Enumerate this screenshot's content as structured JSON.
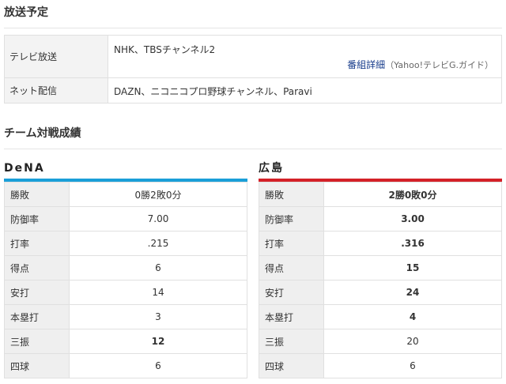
{
  "broadcast": {
    "title": "放送予定",
    "rows": [
      {
        "label": "テレビ放送",
        "value": "NHK、TBSチャンネル2",
        "detail_link": "番組詳細",
        "detail_source": "（Yahoo!テレビG.ガイド）"
      },
      {
        "label": "ネット配信",
        "value": "DAZN、ニコニコプロ野球チャンネル、Paravi"
      }
    ]
  },
  "record": {
    "title": "チーム対戦成績",
    "teams": [
      {
        "name": "DeNA",
        "color": "#1a9fd8",
        "stats": [
          {
            "label": "勝敗",
            "value": "0勝2敗0分",
            "bold": false
          },
          {
            "label": "防御率",
            "value": "7.00",
            "bold": false
          },
          {
            "label": "打率",
            "value": ".215",
            "bold": false
          },
          {
            "label": "得点",
            "value": "6",
            "bold": false
          },
          {
            "label": "安打",
            "value": "14",
            "bold": false
          },
          {
            "label": "本塁打",
            "value": "3",
            "bold": false
          },
          {
            "label": "三振",
            "value": "12",
            "bold": true
          },
          {
            "label": "四球",
            "value": "6",
            "bold": false
          }
        ]
      },
      {
        "name": "広島",
        "color": "#d42128",
        "stats": [
          {
            "label": "勝敗",
            "value": "2勝0敗0分",
            "bold": true
          },
          {
            "label": "防御率",
            "value": "3.00",
            "bold": true
          },
          {
            "label": "打率",
            "value": ".316",
            "bold": true
          },
          {
            "label": "得点",
            "value": "15",
            "bold": true
          },
          {
            "label": "安打",
            "value": "24",
            "bold": true
          },
          {
            "label": "本塁打",
            "value": "4",
            "bold": true
          },
          {
            "label": "三振",
            "value": "20",
            "bold": false
          },
          {
            "label": "四球",
            "value": "6",
            "bold": false
          }
        ]
      }
    ]
  }
}
